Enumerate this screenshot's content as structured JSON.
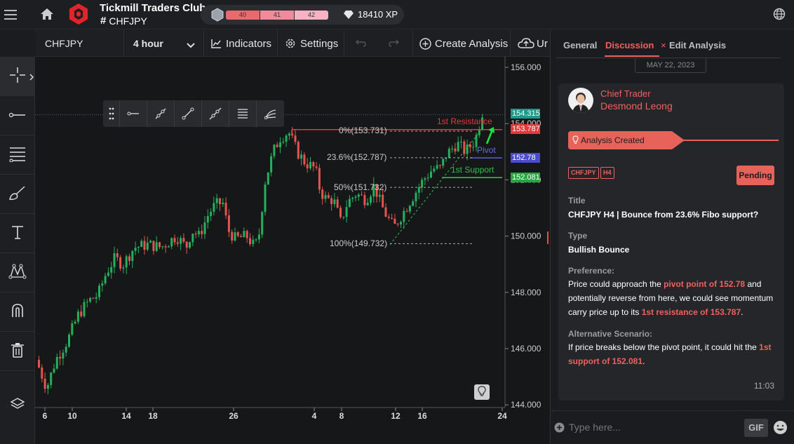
{
  "header": {
    "club_name": "Tickmill Traders Club",
    "channel": "CHFJPY",
    "levels": [
      "40",
      "41",
      "42"
    ],
    "xp": "18410 XP"
  },
  "toolbar": {
    "symbol": "CHFJPY",
    "timeframe": "4 hour",
    "indicators_label": "Indicators",
    "settings_label": "Settings",
    "create_analysis_label": "Create Analysis",
    "upload_label": "Ur"
  },
  "chart": {
    "price_axis": [
      "156.000",
      "154.000",
      "152.000",
      "150.000",
      "148.000",
      "146.000",
      "144.000"
    ],
    "date_axis": [
      "6",
      "10",
      "14",
      "18",
      "26",
      "4",
      "8",
      "12",
      "16",
      "24"
    ],
    "current_price": "154.315",
    "resistance_price": "153.787",
    "pivot_price": "152.78",
    "support_price": "152.081",
    "resistance_label": "1st Resistance",
    "pivot_label": "Pivot",
    "support_label": "1st Support",
    "fib": [
      "0%(153.731)",
      "23.6%(152.787)",
      "50%(151.732)",
      "100%(149.732)"
    ],
    "colors": {
      "up": "#25b05b",
      "down": "#e3554f",
      "resistance": "#e5383b",
      "pivot": "#5b5be6",
      "support": "#2ec14a",
      "current": "#1d9a8a"
    }
  },
  "panel": {
    "tabs": [
      "General",
      "Discussion",
      "Edit Analysis"
    ],
    "date": "MAY 22, 2023",
    "author_role": "Chief Trader",
    "author_name": "Desmond Leong",
    "status_banner": "Analysis Created",
    "tags": [
      "CHFJPY",
      "H4"
    ],
    "badge": "Pending",
    "title_label": "Title",
    "title": "CHFJPY H4 | Bounce from 23.6% Fibo support?",
    "type_label": "Type",
    "type": "Bullish Bounce",
    "preference_label": "Preference:",
    "preference_1": "Price could approach the ",
    "preference_hl1": "pivot point of 152.78",
    "preference_2": " and potentially reverse from here, we could see momentum carry price up to its ",
    "preference_hl2": "1st resistance of 153.787",
    "preference_3": ".",
    "alt_label": "Alternative Scenario:",
    "alt_1": "If price breaks below the pivot point, it could hit the ",
    "alt_hl": "1st support of 152.081",
    "alt_2": ".",
    "time": "11:03",
    "input_placeholder": "Type here...",
    "gif_label": "GIF"
  }
}
